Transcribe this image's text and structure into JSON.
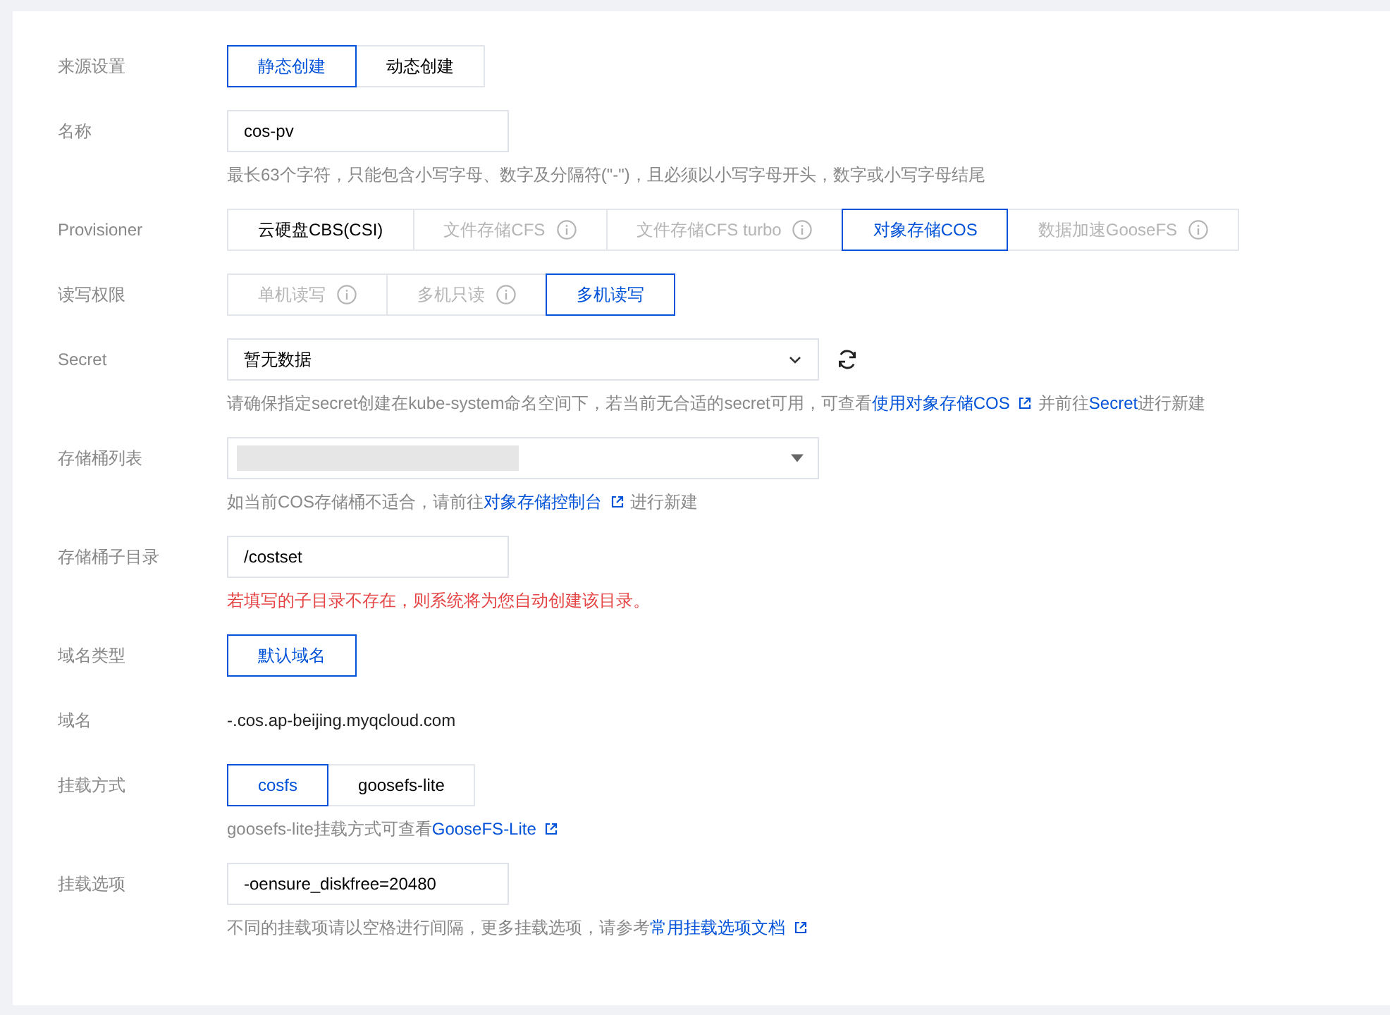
{
  "rows": [
    {
      "label": "来源设置",
      "kind": "segmented",
      "options": [
        {
          "label": "静态创建",
          "selected": true,
          "disabled": false,
          "info": false
        },
        {
          "label": "动态创建",
          "selected": false,
          "disabled": false,
          "info": false
        }
      ]
    },
    {
      "label": "名称",
      "kind": "input",
      "value": "cos-pv",
      "help": {
        "error": false,
        "parts": [
          {
            "text": "最长63个字符，只能包含小写字母、数字及分隔符(\"-\")，且必须以小写字母开头，数字或小写字母结尾",
            "link": false
          }
        ]
      }
    },
    {
      "label": "Provisioner",
      "kind": "segmented",
      "options": [
        {
          "label": "云硬盘CBS(CSI)",
          "selected": false,
          "disabled": false,
          "info": false
        },
        {
          "label": "文件存储CFS",
          "selected": false,
          "disabled": true,
          "info": true
        },
        {
          "label": "文件存储CFS turbo",
          "selected": false,
          "disabled": true,
          "info": true
        },
        {
          "label": "对象存储COS",
          "selected": true,
          "disabled": false,
          "info": false
        },
        {
          "label": "数据加速GooseFS",
          "selected": false,
          "disabled": true,
          "info": true
        }
      ]
    },
    {
      "label": "读写权限",
      "kind": "segmented",
      "options": [
        {
          "label": "单机读写",
          "selected": false,
          "disabled": true,
          "info": true
        },
        {
          "label": "多机只读",
          "selected": false,
          "disabled": true,
          "info": true
        },
        {
          "label": "多机读写",
          "selected": true,
          "disabled": false,
          "info": false
        }
      ]
    },
    {
      "label": "Secret",
      "kind": "select",
      "value": "暂无数据",
      "refresh": true,
      "help": {
        "error": false,
        "parts": [
          {
            "text": "请确保指定secret创建在kube-system命名空间下，若当前无合适的secret可用，可查看",
            "link": false
          },
          {
            "text": "使用对象存储COS",
            "link": true,
            "external": true
          },
          {
            "text": "并前往",
            "link": false
          },
          {
            "text": "Secret",
            "link": true,
            "external": false
          },
          {
            "text": "进行新建",
            "link": false
          }
        ]
      }
    },
    {
      "label": "存储桶列表",
      "kind": "masked-select",
      "help": {
        "error": false,
        "parts": [
          {
            "text": "如当前COS存储桶不适合，请前往",
            "link": false
          },
          {
            "text": "对象存储控制台",
            "link": true,
            "external": true
          },
          {
            "text": "进行新建",
            "link": false
          }
        ]
      }
    },
    {
      "label": "存储桶子目录",
      "kind": "input",
      "value": "/costset",
      "help": {
        "error": true,
        "parts": [
          {
            "text": "若填写的子目录不存在，则系统将为您自动创建该目录。",
            "link": false
          }
        ]
      }
    },
    {
      "label": "域名类型",
      "kind": "segmented",
      "options": [
        {
          "label": "默认域名",
          "selected": true,
          "disabled": false,
          "info": false
        }
      ]
    },
    {
      "label": "域名",
      "kind": "text",
      "value": "-.cos.ap-beijing.myqcloud.com"
    },
    {
      "label": "挂载方式",
      "kind": "segmented",
      "options": [
        {
          "label": "cosfs",
          "selected": true,
          "disabled": false,
          "info": false
        },
        {
          "label": "goosefs-lite",
          "selected": false,
          "disabled": false,
          "info": false
        }
      ],
      "help": {
        "error": false,
        "parts": [
          {
            "text": "goosefs-lite挂载方式可查看",
            "link": false
          },
          {
            "text": "GooseFS-Lite",
            "link": true,
            "external": true
          }
        ]
      }
    },
    {
      "label": "挂载选项",
      "kind": "input",
      "value": "-oensure_diskfree=20480",
      "help": {
        "error": false,
        "parts": [
          {
            "text": "不同的挂载项请以空格进行间隔，更多挂载选项，请参考",
            "link": false
          },
          {
            "text": "常用挂载选项文档",
            "link": true,
            "external": true
          }
        ]
      }
    }
  ]
}
